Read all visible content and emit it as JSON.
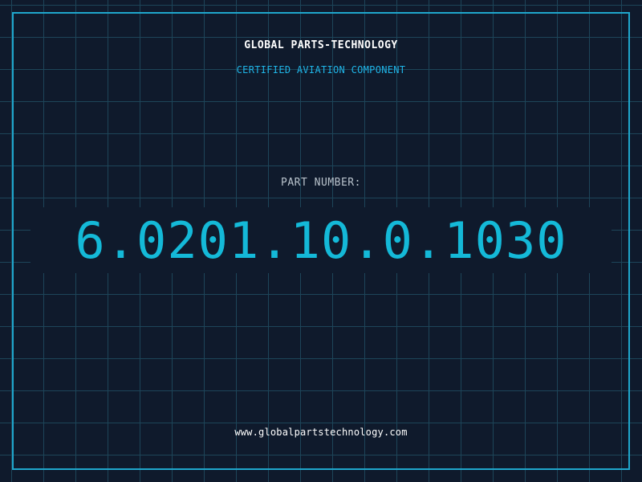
{
  "colors": {
    "background": "#0f1a2c",
    "grid_line": "#1f4a5e",
    "frame": "#1fa6cc",
    "accent_cyan": "#14b9d8",
    "subtitle": "#1fb4e6",
    "label_gray": "#b9c3cc",
    "text_white": "#ffffff"
  },
  "header": {
    "brand": "GLOBAL PARTS-TECHNOLOGY",
    "subtitle": "CERTIFIED AVIATION COMPONENT"
  },
  "part": {
    "label": "PART NUMBER:",
    "number": "6.0201.10.0.1030"
  },
  "footer": {
    "website": "www.globalpartstechnology.com"
  }
}
